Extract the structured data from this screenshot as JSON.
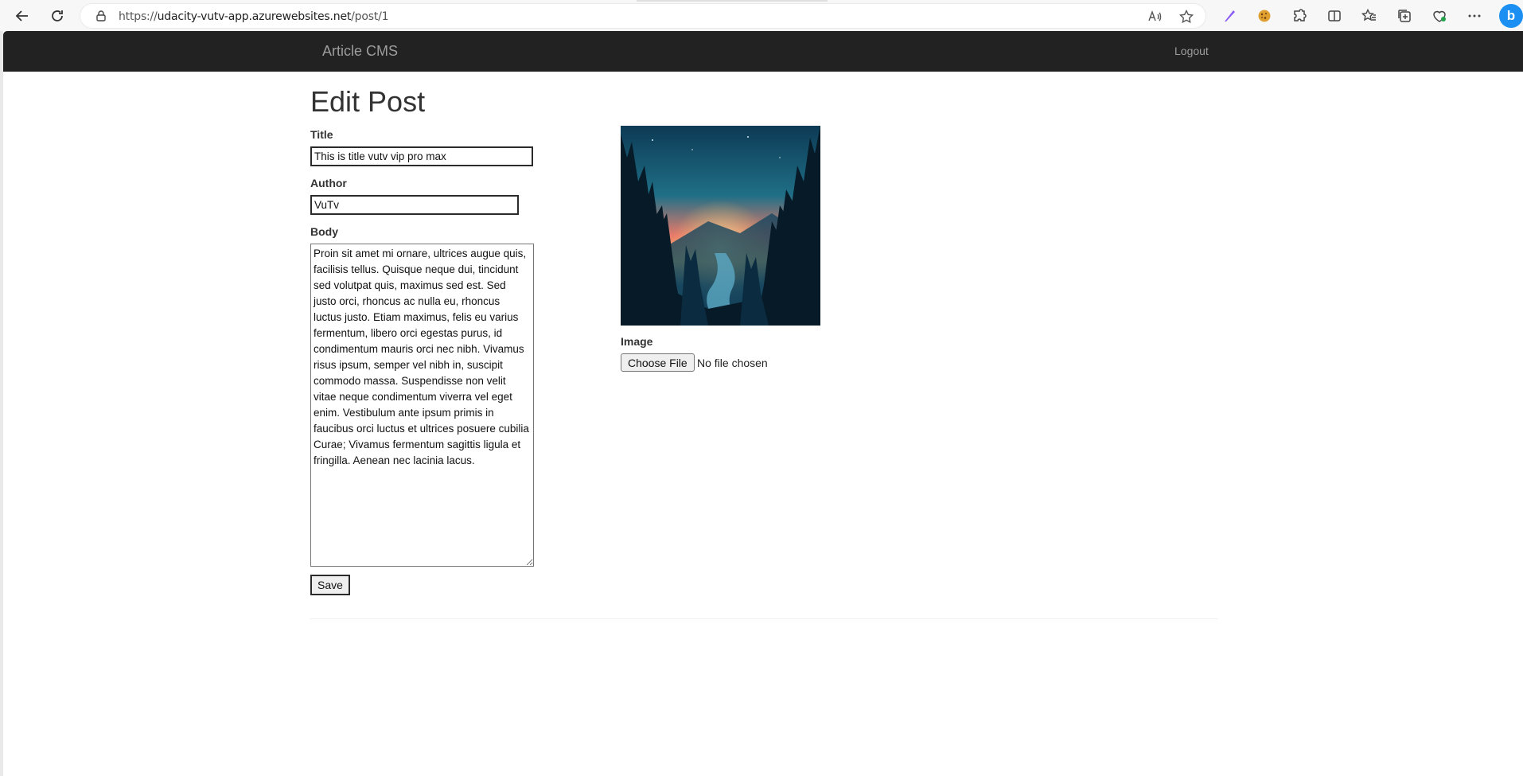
{
  "browser": {
    "url_prefix": "https://",
    "url_host": "udacity-vutv-app.azurewebsites.net",
    "url_path": "/post/1",
    "icons": [
      "back-icon",
      "refresh-icon",
      "lock-icon",
      "read-aloud-icon",
      "favorite-star-icon",
      "pen-icon",
      "cookie-icon",
      "extensions-icon",
      "split-screen-icon",
      "favorites-icon",
      "collections-icon",
      "browser-essentials-icon",
      "more-icon",
      "bing-icon"
    ],
    "bing_letter": "b"
  },
  "navbar": {
    "brand": "Article CMS",
    "logout": "Logout"
  },
  "form": {
    "page_title": "Edit Post",
    "title_label": "Title",
    "title_value": "This is title vutv vip pro max",
    "author_label": "Author",
    "author_value": "VuTv",
    "body_label": "Body",
    "body_value": "Proin sit amet mi ornare, ultrices augue quis, facilisis tellus. Quisque neque dui, tincidunt sed volutpat quis, maximus sed est. Sed justo orci, rhoncus ac nulla eu, rhoncus luctus justo. Etiam maximus, felis eu varius fermentum, libero orci egestas purus, id condimentum mauris orci nec nibh. Vivamus risus ipsum, semper vel nibh in, suscipit commodo massa. Suspendisse non velit vitae neque condimentum viverra vel eget enim. Vestibulum ante ipsum primis in faucibus orci luctus et ultrices posuere cubilia Curae; Vivamus fermentum sagittis ligula et fringilla. Aenean nec lacinia lacus.",
    "save_label": "Save",
    "image_label": "Image",
    "file_button": "Choose File",
    "file_status": "No file chosen"
  },
  "colors": {
    "navbar_bg": "#222222",
    "navbar_text": "#9d9d9d",
    "bing_blue": "#1b8ff2"
  }
}
